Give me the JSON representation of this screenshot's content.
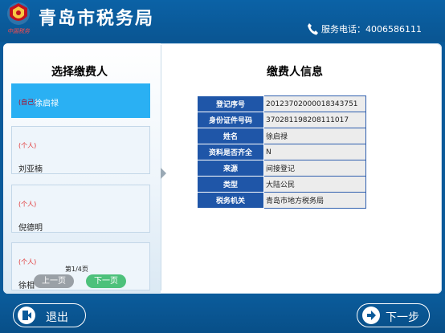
{
  "header": {
    "title": "青岛市税务局",
    "emblem_text": "中国税务",
    "hotline": "服务电话：4006586111"
  },
  "left": {
    "title": "选择缴费人",
    "payers": [
      {
        "type": "(自己)",
        "name": "徐启禄",
        "selected": true
      },
      {
        "type": "(个人)",
        "name": "刘亚楠",
        "selected": false
      },
      {
        "type": "(个人)",
        "name": "倪德明",
        "selected": false
      },
      {
        "type": "(个人)",
        "name": "徐相",
        "selected": false
      }
    ],
    "pager": {
      "label": "第1/4页",
      "prev": "上一页",
      "next": "下一页"
    }
  },
  "right": {
    "title": "缴费人信息",
    "rows": [
      {
        "key": "登记序号",
        "value": "20123702000018343751"
      },
      {
        "key": "身份证件号码",
        "value": "370281198208111017"
      },
      {
        "key": "姓名",
        "value": "徐启禄"
      },
      {
        "key": "资料是否齐全",
        "value": "N"
      },
      {
        "key": "来源",
        "value": "间接登记"
      },
      {
        "key": "类型",
        "value": "大陆公民"
      },
      {
        "key": "税务机关",
        "value": "青岛市地方税务局"
      }
    ]
  },
  "footer": {
    "exit": "退出",
    "next_step": "下一步"
  },
  "colors": {
    "brand_blue": "#0a5a9a",
    "selected": "#2ab0f3",
    "table_key": "#1f56a8",
    "next_green": "#4dc17b"
  }
}
